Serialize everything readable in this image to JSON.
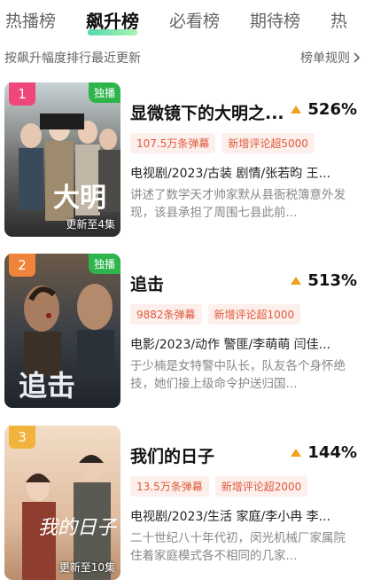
{
  "tabs": [
    "热播榜",
    "飙升榜",
    "必看榜",
    "期待榜",
    "热"
  ],
  "active_tab": 1,
  "subbar": {
    "description": "按飙升幅度排行最近更新",
    "rules_label": "榜单规则"
  },
  "items": [
    {
      "rank": "1",
      "rank_color": "#f0477a",
      "exclusive": "独播",
      "update": "更新至4集",
      "title": "显微镜下的大明之...",
      "percent": "526%",
      "tag1": "107.5万条弹幕",
      "tag2": "新增评论超5000",
      "meta": "电视剧/2023/古装 剧情/张若昀 王...",
      "synopsis": "讲述了数学天才帅家默从县衙税簿意外发现，该县承担了周围七县此前..."
    },
    {
      "rank": "2",
      "rank_color": "#f0843a",
      "exclusive": "独播",
      "update": "",
      "title": "追击",
      "percent": "513%",
      "tag1": "9882条弹幕",
      "tag2": "新增评论超1000",
      "meta": "电影/2023/动作 警匪/李萌萌 闫佳...",
      "synopsis": "于少楠是女特警中队长，队友各个身怀绝技，她们接上级命令护送归国..."
    },
    {
      "rank": "3",
      "rank_color": "#f2b33d",
      "exclusive": "",
      "update": "更新至10集",
      "title": "我们的日子",
      "percent": "144%",
      "tag1": "13.5万条弹幕",
      "tag2": "新增评论超2000",
      "meta": "电视剧/2023/生活 家庭/李小冉 李...",
      "synopsis": "二十世纪八十年代初，闵光机械厂家属院住着家庭模式各不相同的几家..."
    }
  ]
}
